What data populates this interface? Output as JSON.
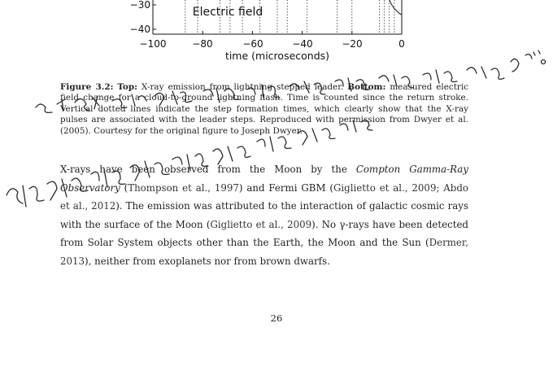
{
  "figure": {
    "y_tick_labels": [
      "−30",
      "−40"
    ],
    "x_tick_labels": [
      "−100",
      "−80",
      "−60",
      "−40",
      "−20",
      "0"
    ],
    "x_axis_label": "time (microseconds)",
    "panel_label": "Electric field"
  },
  "chart_data": {
    "type": "line",
    "title": "",
    "xlabel": "time (microseconds)",
    "ylabel": "",
    "xlim": [
      -100,
      0
    ],
    "ylim": [
      -40,
      -27
    ],
    "annotations": [
      "Electric field"
    ],
    "series": [
      {
        "x": [
          -100,
          -60,
          -20,
          -6,
          -5,
          -4,
          -3,
          -2,
          -1,
          0
        ],
        "values": [
          -27,
          -27,
          -27,
          -27,
          -28,
          -30,
          -31.5,
          -32.5,
          -33.5,
          -34
        ]
      }
    ],
    "step_marker_times": [
      -87,
      -82,
      -73,
      -69,
      -64,
      -57,
      -50,
      -46,
      -38,
      -26,
      -20,
      -9,
      -7,
      -5,
      -3
    ]
  },
  "caption": {
    "figure_label": "Figure 3.2:",
    "top_label": "Top:",
    "text_1": " X-ray emission from lightning stepped leader. ",
    "bottom_label": "Bottom:",
    "text_2": " measured electric field change for a cloud-to-ground lightning flash. Time is counted since the return stroke. Vertical dotted lines indicate the step formation times, which clearly show that the X-ray pulses are associated with the leader steps. Reproduced with permission from Dwyer et al. (2005). Courtesy for the original figure to Joseph Dwyer."
  },
  "body": {
    "p1": "X-rays have been observed from the Moon by the ",
    "observatory": "Compton Gamma-Ray Observatory",
    "p2": " (",
    "cite1": "Thompson et al., 1997",
    "p3": ") and Fermi GBM (",
    "cite2": "Giglietto et al., 2009; Abdo et al., 2012",
    "p4": "). The emission was attributed to the interaction of galactic cosmic rays with the surface of the Moon (",
    "cite3": "Giglietto et al., 2009",
    "p5": "). No γ-rays have been detected from Solar System objects other than the Earth, the Moon and the Sun (",
    "cite4": "Dermer, 2013",
    "p6": "), neither from exoplanets nor from brown dwarfs."
  },
  "page_number": "26"
}
